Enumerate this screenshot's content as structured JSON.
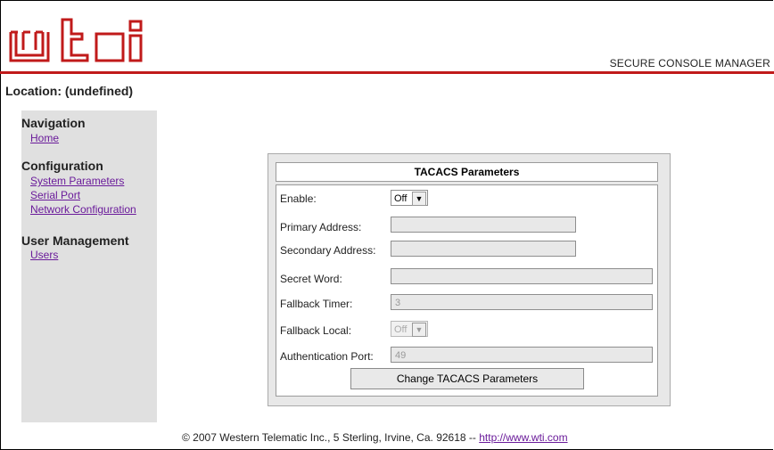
{
  "header": {
    "product": "SECURE CONSOLE MANAGER",
    "location": "Location: (undefined)",
    "brand_color": "#c01a1a",
    "logo_text": "wti"
  },
  "sidebar": {
    "navigation_heading": "Navigation",
    "home": "Home",
    "configuration_heading": "Configuration",
    "system_parameters": "System Parameters",
    "serial_port": "Serial Port",
    "network_configuration": "Network Configuration",
    "user_management_heading": "User Management",
    "users": "Users"
  },
  "panel": {
    "title": "TACACS Parameters",
    "enable_label": "Enable:",
    "enable_value": "Off",
    "primary_label": "Primary Address:",
    "primary_value": "",
    "secondary_label": "Secondary Address:",
    "secondary_value": "",
    "secret_label": "Secret Word:",
    "secret_value": "",
    "fallback_timer_label": "Fallback Timer:",
    "fallback_timer_value": "3",
    "fallback_local_label": "Fallback Local:",
    "fallback_local_value": "Off",
    "auth_port_label": "Authentication Port:",
    "auth_port_value": "49",
    "submit_label": "Change TACACS Parameters"
  },
  "footer": {
    "text": "© 2007 Western Telematic Inc., 5 Sterling, Irvine, Ca. 92618 -- ",
    "link": "http://www.wti.com"
  }
}
